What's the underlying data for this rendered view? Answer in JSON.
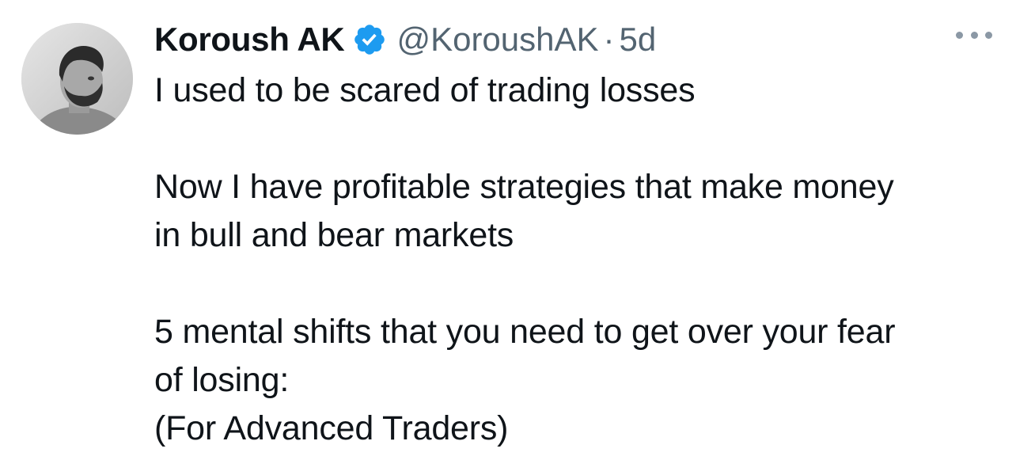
{
  "tweet": {
    "author": {
      "display_name": "Koroush AK",
      "handle": "@KoroushAK",
      "verified": true,
      "verified_icon": "verified-badge-icon",
      "verified_color": "#1d9bf0"
    },
    "separator": "·",
    "age": "5d",
    "more_icon": "more-options-icon",
    "body": {
      "paragraph_1": {
        "line_1": "I used to be scared of trading losses"
      },
      "paragraph_2": {
        "line_1": "Now I have profitable strategies that make money",
        "line_2": "in bull and bear markets"
      },
      "paragraph_3": {
        "line_1": "5 mental shifts that you need to get over your fear",
        "line_2": "of losing:",
        "line_3": "(For Advanced Traders)"
      }
    }
  }
}
